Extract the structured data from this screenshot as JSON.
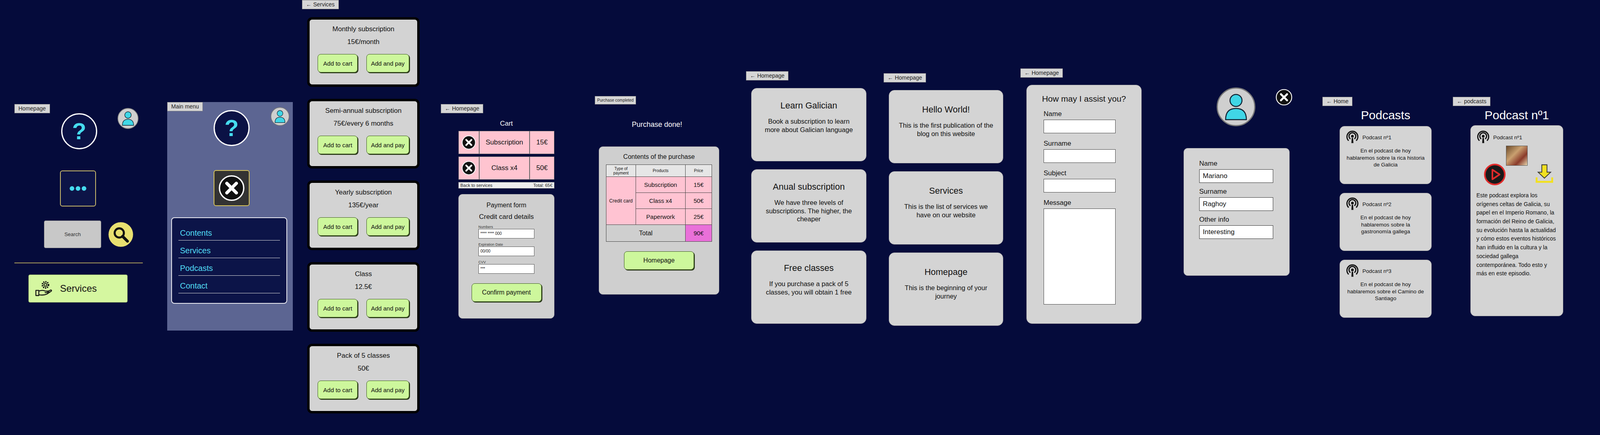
{
  "home": {
    "tag": "Homepage",
    "help": "?",
    "search": {
      "placeholder": "Search"
    },
    "services_button": "Services"
  },
  "main_menu": {
    "tag": "Main menu",
    "help": "?",
    "items": [
      "Contents",
      "Services",
      "Podcasts",
      "Contact"
    ]
  },
  "services": {
    "tag": "← Services",
    "cards": [
      {
        "title": "Monthly subscription",
        "price": "15€/month",
        "buttons": [
          "Add to cart",
          "Add and pay"
        ]
      },
      {
        "title": "Semi-annual subscription",
        "price": "75€/every 6 months",
        "buttons": [
          "Add to cart",
          "Add and pay"
        ]
      },
      {
        "title": "Yearly subscription",
        "price": "135€/year",
        "buttons": [
          "Add to cart",
          "Add and pay"
        ]
      },
      {
        "title": "Class",
        "price": "12.5€",
        "buttons": [
          "Add to cart",
          "Add and pay"
        ]
      },
      {
        "title": "Pack of 5 classes",
        "price": "50€",
        "buttons": [
          "Add to cart",
          "Add and pay"
        ]
      }
    ]
  },
  "cart": {
    "tag": "← Homepage",
    "title": "Cart",
    "items": [
      {
        "name": "Subscription",
        "price": "15€"
      },
      {
        "name": "Class x4",
        "price": "50€"
      }
    ],
    "back": "Back to services",
    "total": "Total: 65€",
    "form": {
      "title": "Payment form",
      "subtitle": "Credit card details",
      "fields": [
        {
          "label": "Numbers",
          "value": "**** **** 000"
        },
        {
          "label": "Expiration Date",
          "value": "00/00"
        },
        {
          "label": "CVV",
          "value": "***"
        }
      ],
      "button": "Confirm payment"
    }
  },
  "purchase": {
    "tag": "Purchase completed",
    "title": "Purchase done!",
    "panel_title": "Contents of the purchase",
    "columns": [
      "Type of payment",
      "Products",
      "Price"
    ],
    "payment_type": "Credit card",
    "rows": [
      [
        "Subscription",
        "15€"
      ],
      [
        "Class x4",
        "50€"
      ],
      [
        "Paperwork",
        "25€"
      ]
    ],
    "total_label": "Total",
    "total": "90€",
    "button": "Homepage"
  },
  "info": {
    "tag": "← Homepage",
    "cards": [
      {
        "title": "Learn Galician",
        "text": "Book a subscription to learn more about Galician language"
      },
      {
        "title": "Anual subscription",
        "text": "We have three levels of subscriptions. The higher, the cheaper"
      },
      {
        "title": "Free classes",
        "text": "If you purchase a pack of 5 classes, you will obtain 1 free"
      }
    ]
  },
  "blog": {
    "tag": "← Homepage",
    "cards": [
      {
        "title": "Hello World!",
        "text": "This is the first publication of the blog on this website"
      },
      {
        "title": "Services",
        "text": "This is the list of services we have on our website"
      },
      {
        "title": "Homepage",
        "text": "This is the beginning of your journey"
      }
    ]
  },
  "contact": {
    "tag": "← Homepage",
    "title": "How may I assist you?",
    "fields": [
      "Name",
      "Surname",
      "Subject"
    ],
    "message": "Message"
  },
  "profile": {
    "fields": [
      {
        "label": "Name",
        "value": "Mariano"
      },
      {
        "label": "Surname",
        "value": "Raghoy"
      },
      {
        "label": "Other info",
        "value": "Interesting"
      }
    ]
  },
  "podcasts": {
    "tag": "← Home",
    "title": "Podcasts",
    "items": [
      {
        "title": "Podcast nº1",
        "text": "En el podcast de hoy hablaremos sobre la rica historia de Galicia"
      },
      {
        "title": "Podcast nº2",
        "text": "En el podcast de hoy hablaremos sobre la gastronomía gallega"
      },
      {
        "title": "Podcast nº3",
        "text": "En el podcast de hoy hablaremos sobre el Camino de Santiago"
      }
    ]
  },
  "podcast_detail": {
    "tag": "← podcasts",
    "title": "Podcast nº1",
    "card_title": "Podcast nº1",
    "text": "Este podcast explora los orígenes celtas de Galicia, su papel en el Imperio Romano, la formación del Reino de Galicia, su evolución hasta la actualidad y cómo estos eventos históricos han influido en la cultura y la sociedad gallega contemporánea. Todo esto y más en este episodio."
  }
}
